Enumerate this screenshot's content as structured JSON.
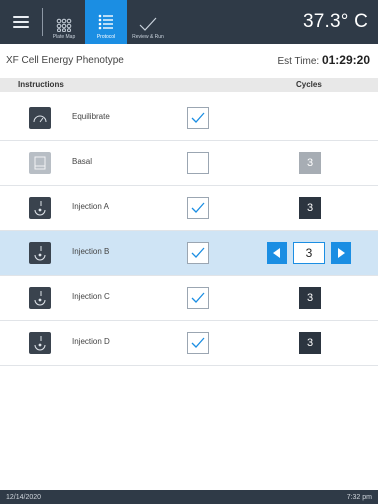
{
  "header": {
    "temperature": "37.3° C",
    "tabs": [
      {
        "label": "Plate Map",
        "icon": "plate-map-icon"
      },
      {
        "label": "Protocol",
        "icon": "protocol-list-icon",
        "active": true
      },
      {
        "label": "Review & Run",
        "icon": "review-check-icon"
      }
    ]
  },
  "assay": {
    "name": "XF Cell Energy Phenotype",
    "est_label": "Est Time:",
    "est_value": "01:29:20"
  },
  "columns": {
    "instructions": "Instructions",
    "cycles": "Cycles"
  },
  "rows": [
    {
      "name": "Equilibrate",
      "icon": "equilibrate-icon",
      "checked": true,
      "cycles": null
    },
    {
      "name": "Basal",
      "icon": "basal-icon",
      "checked": false,
      "cycles": "3"
    },
    {
      "name": "Injection A",
      "icon": "injection-icon",
      "checked": true,
      "cycles": "3"
    },
    {
      "name": "Injection B",
      "icon": "injection-icon",
      "checked": true,
      "cycles": "3",
      "selected": true
    },
    {
      "name": "Injection C",
      "icon": "injection-icon",
      "checked": true,
      "cycles": "3"
    },
    {
      "name": "Injection D",
      "icon": "injection-icon",
      "checked": true,
      "cycles": "3"
    }
  ],
  "status": {
    "date": "12/14/2020",
    "time": "7:32 pm"
  },
  "colors": {
    "topbar": "#2f3a47",
    "accent": "#1b8ee3",
    "selected_row": "#cfe4f5"
  }
}
